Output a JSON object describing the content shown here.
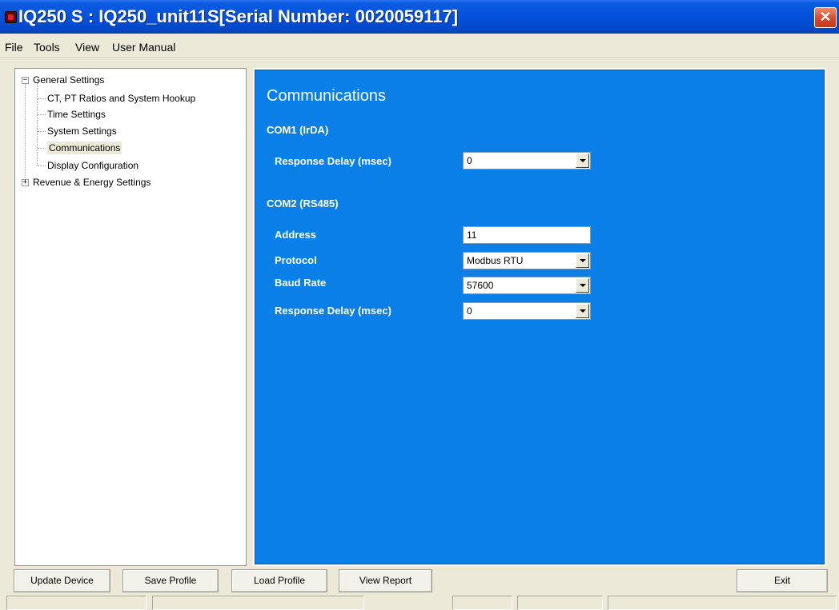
{
  "window": {
    "title": "IQ250 S : IQ250_unit11S[Serial Number: 0020059117]",
    "close_symbol": "✕",
    "app_icon": "device-icon",
    "close_icon": "close-icon"
  },
  "menu": {
    "file": "File",
    "tools": "Tools",
    "view": "View",
    "user_manual": "User Manual"
  },
  "tree": {
    "general_settings": "General Settings",
    "ct_pt": "CT, PT Ratios and System Hookup",
    "time_settings": "Time Settings",
    "system_settings": "System Settings",
    "communications": "Communications",
    "display_configuration": "Display Configuration",
    "revenue_energy": "Revenue & Energy Settings",
    "expanded_symbol": "−",
    "collapsed_symbol": "+"
  },
  "panel": {
    "title": "Communications",
    "com1": {
      "heading": "COM1 (IrDA)",
      "response_delay_label": "Response Delay (msec)",
      "response_delay_value": "0"
    },
    "com2": {
      "heading": "COM2 (RS485)",
      "address_label": "Address",
      "address_value": "11",
      "protocol_label": "Protocol",
      "protocol_value": "Modbus RTU",
      "baud_rate_label": "Baud Rate",
      "baud_rate_value": "57600",
      "response_delay_label": "Response Delay (msec)",
      "response_delay_value": "0"
    }
  },
  "buttons": {
    "update_device": "Update Device",
    "save_profile": "Save Profile",
    "load_profile": "Load Profile",
    "view_report": "View Report",
    "exit": "Exit"
  },
  "colors": {
    "title_bar": "#0551dc",
    "panel_background": "#0a7fe8",
    "close_button": "#d64a2a"
  }
}
